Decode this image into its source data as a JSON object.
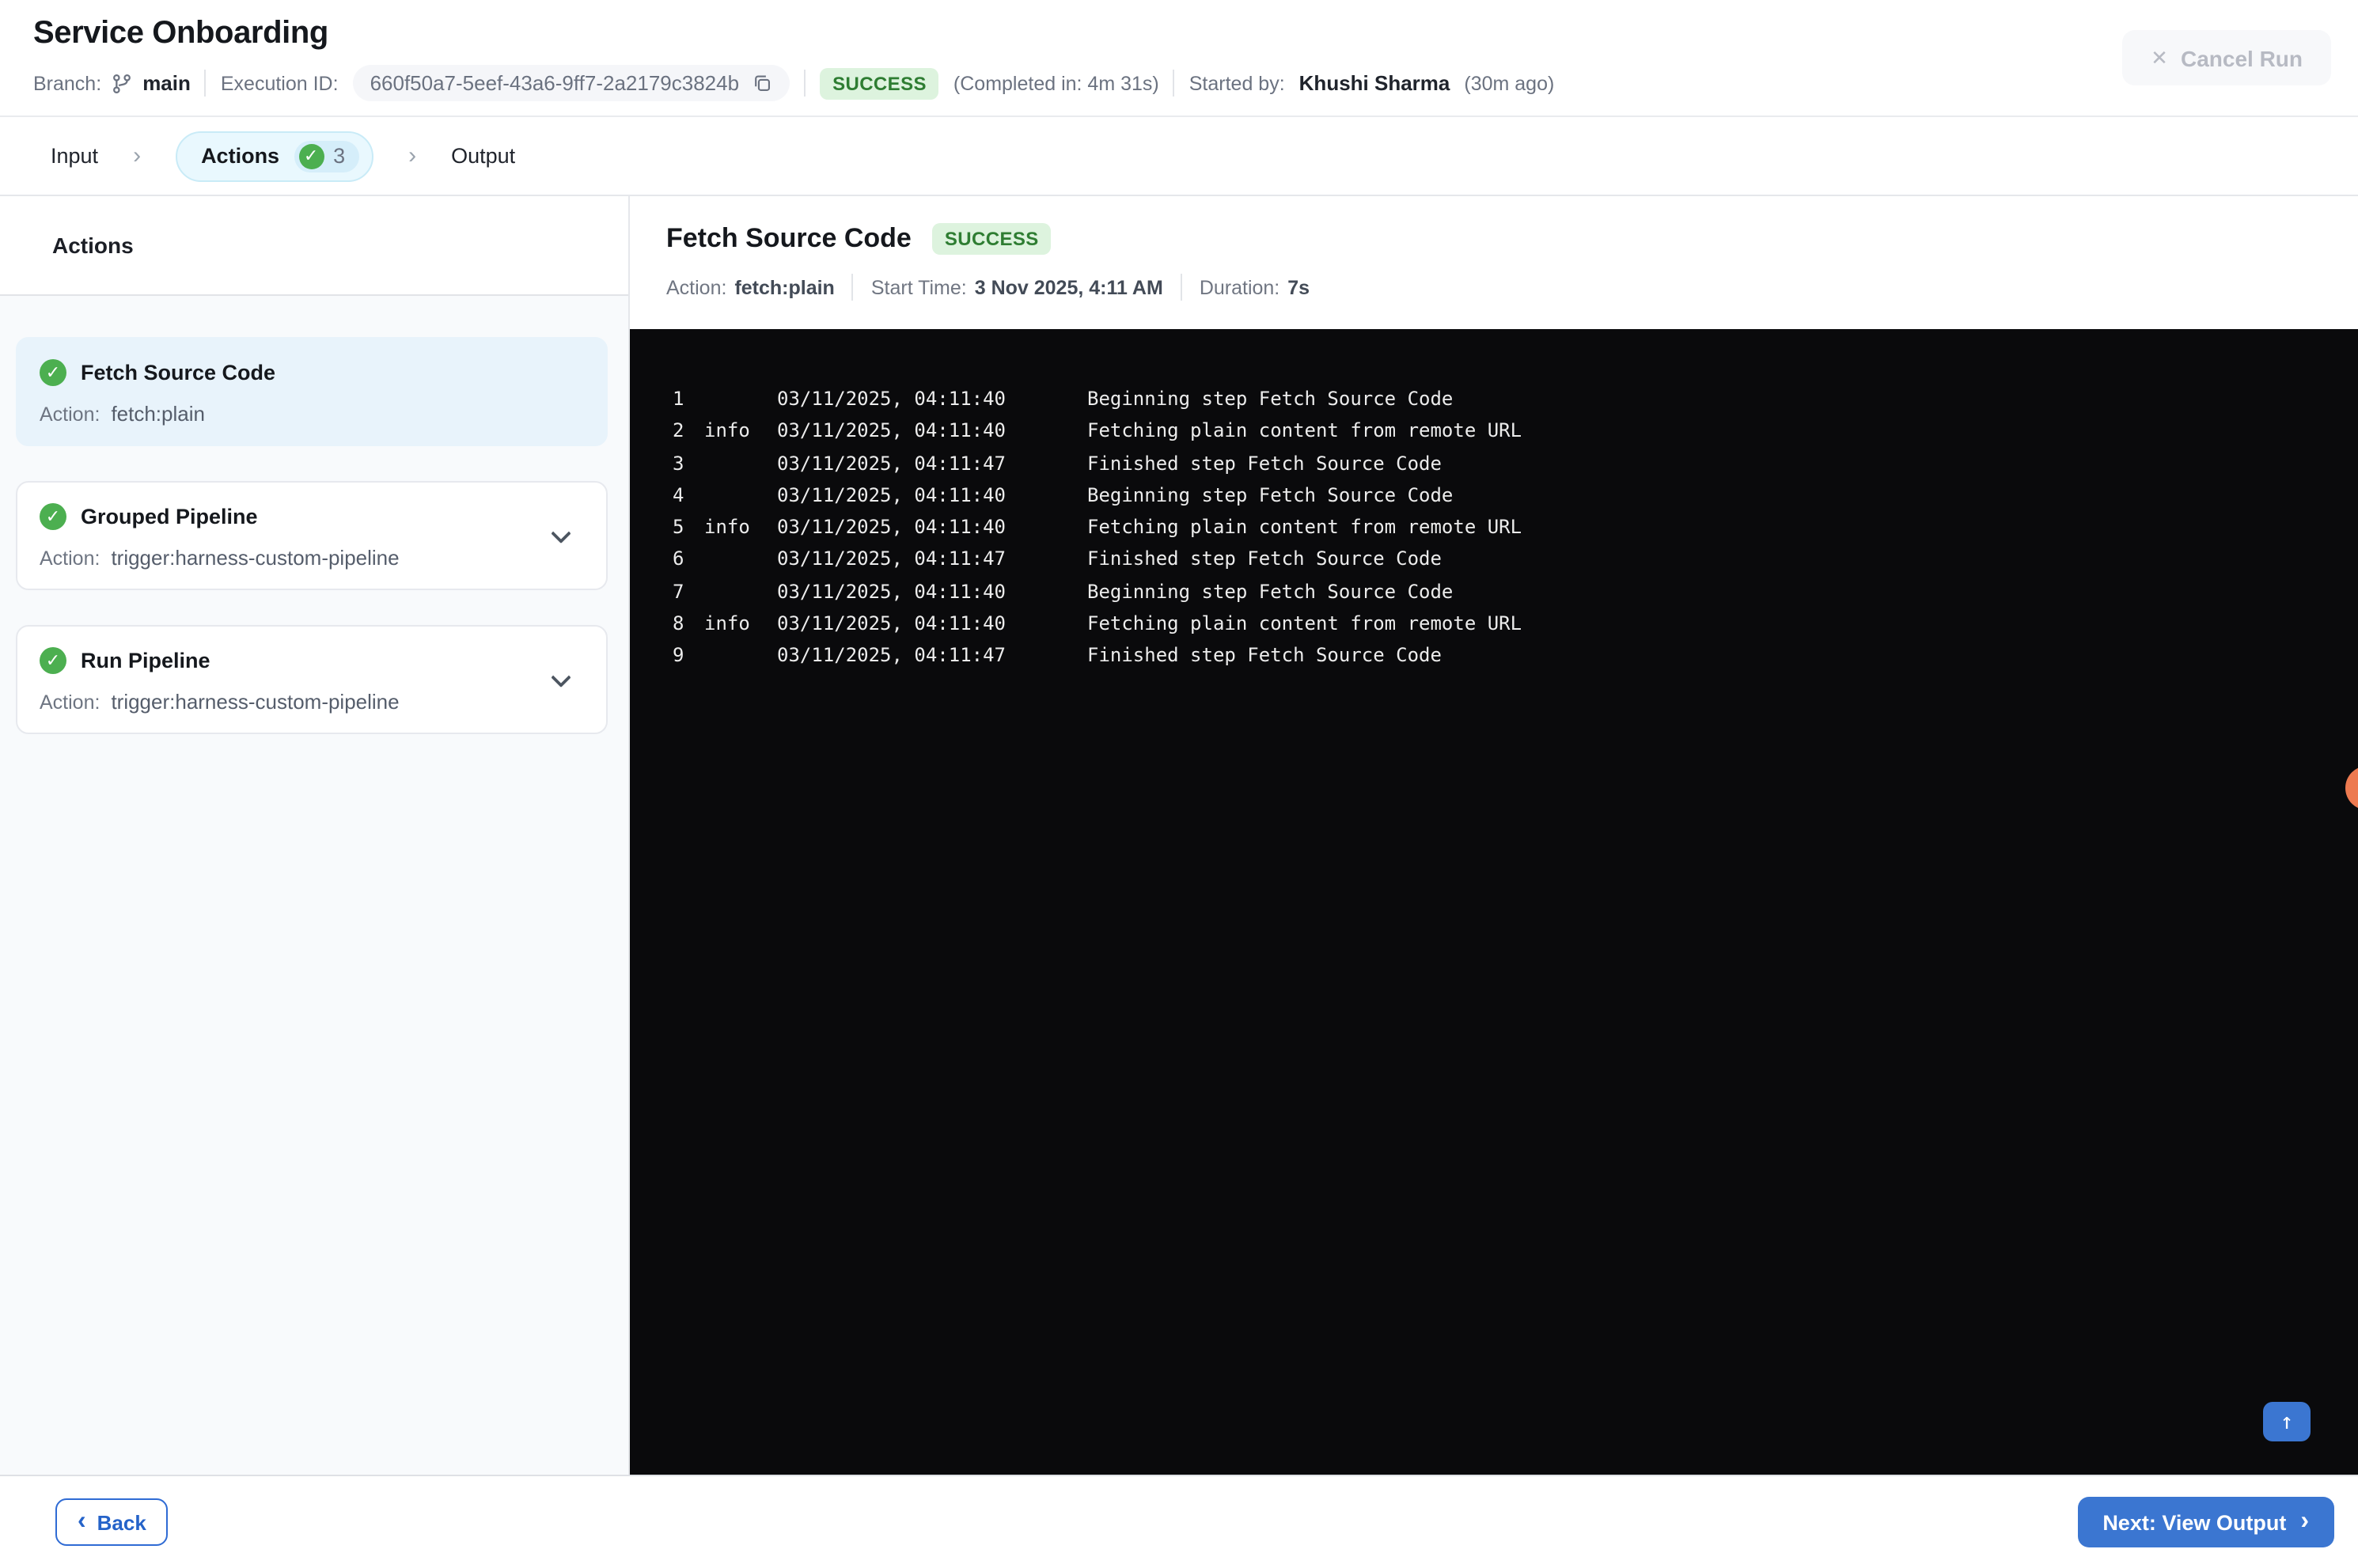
{
  "header": {
    "title": "Service Onboarding",
    "branch_label": "Branch:",
    "branch_name": "main",
    "execution_id_label": "Execution ID:",
    "execution_id": "660f50a7-5eef-43a6-9ff7-2a2179c3824b",
    "status_badge": "SUCCESS",
    "completed_in": "(Completed in: 4m 31s)",
    "started_by_label": "Started by:",
    "started_by_name": "Khushi Sharma",
    "started_ago": "(30m ago)",
    "cancel_run_label": "Cancel Run"
  },
  "tabs": {
    "input_label": "Input",
    "actions_label": "Actions",
    "actions_count": "3",
    "output_label": "Output"
  },
  "sidebar": {
    "heading": "Actions",
    "action_label": "Action:",
    "items": [
      {
        "title": "Fetch Source Code",
        "action": "fetch:plain",
        "selected": true,
        "expandable": false
      },
      {
        "title": "Grouped Pipeline",
        "action": "trigger:harness-custom-pipeline",
        "selected": false,
        "expandable": true
      },
      {
        "title": "Run Pipeline",
        "action": "trigger:harness-custom-pipeline",
        "selected": false,
        "expandable": true
      }
    ]
  },
  "detail": {
    "title": "Fetch Source Code",
    "status_badge": "SUCCESS",
    "meta": [
      {
        "label": "Action:",
        "value": "fetch:plain"
      },
      {
        "label": "Start Time:",
        "value": "3 Nov 2025, 4:11 AM"
      },
      {
        "label": "Duration:",
        "value": "7s"
      }
    ]
  },
  "console": {
    "lines": [
      {
        "num": "1",
        "tag": "",
        "time": "03/11/2025, 04:11:40",
        "message": "Beginning step Fetch Source Code"
      },
      {
        "num": "2",
        "tag": "info",
        "time": "03/11/2025, 04:11:40",
        "message": "Fetching plain content from remote URL"
      },
      {
        "num": "3",
        "tag": "",
        "time": "03/11/2025, 04:11:47",
        "message": "Finished step Fetch Source Code"
      },
      {
        "num": "4",
        "tag": "",
        "time": "03/11/2025, 04:11:40",
        "message": "Beginning step Fetch Source Code"
      },
      {
        "num": "5",
        "tag": "info",
        "time": "03/11/2025, 04:11:40",
        "message": "Fetching plain content from remote URL"
      },
      {
        "num": "6",
        "tag": "",
        "time": "03/11/2025, 04:11:47",
        "message": "Finished step Fetch Source Code"
      },
      {
        "num": "7",
        "tag": "",
        "time": "03/11/2025, 04:11:40",
        "message": "Beginning step Fetch Source Code"
      },
      {
        "num": "8",
        "tag": "info",
        "time": "03/11/2025, 04:11:40",
        "message": "Fetching plain content from remote URL"
      },
      {
        "num": "9",
        "tag": "",
        "time": "03/11/2025, 04:11:47",
        "message": "Finished step Fetch Source Code"
      }
    ]
  },
  "footer": {
    "back_label": "Back",
    "next_label": "Next: View Output"
  },
  "colors": {
    "accent_blue": "#3b76d1",
    "success_green_text": "#2e7d32",
    "success_bg": "#ddf3de",
    "check_green": "#4caf50",
    "console_bg": "#0a0a0c",
    "console_text": "#ececec",
    "orange_dot": "#ed7a50",
    "selected_card_bg": "#e8f3fb",
    "tab_pill_bg": "#e9f8fe",
    "tab_pill_border": "#c9ebf7",
    "count_badge_bg": "#d5eefa"
  }
}
